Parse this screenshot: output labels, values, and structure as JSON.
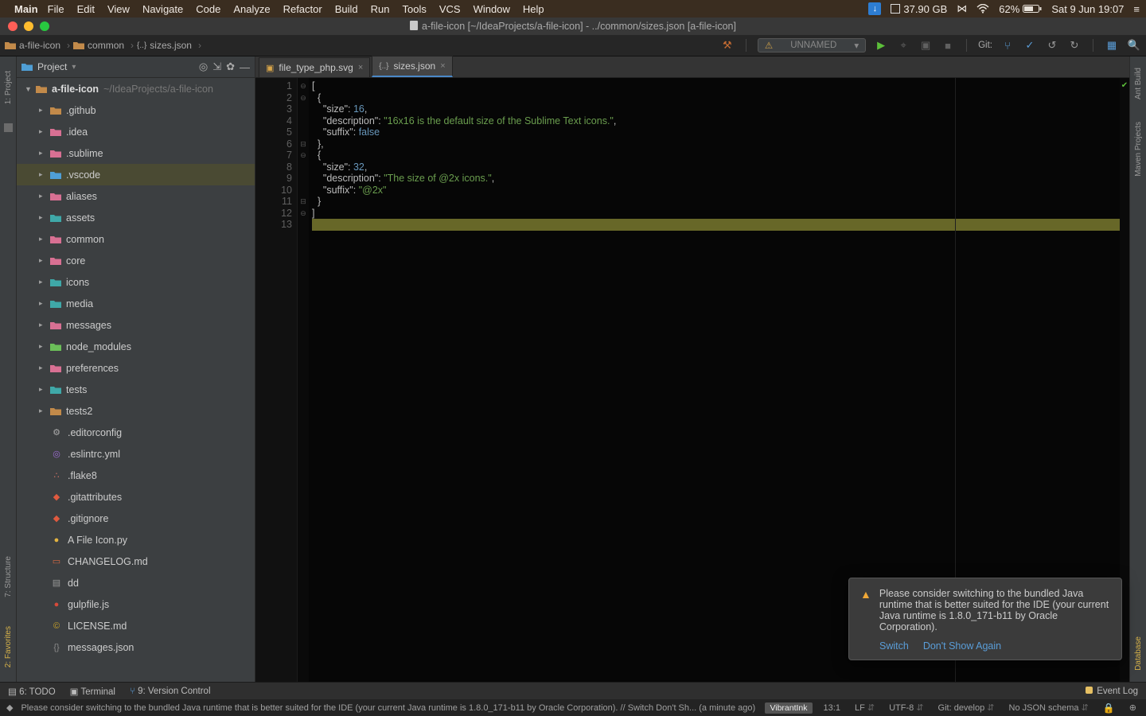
{
  "mac": {
    "app": "Main",
    "menus": [
      "File",
      "Edit",
      "View",
      "Navigate",
      "Code",
      "Analyze",
      "Refactor",
      "Build",
      "Run",
      "Tools",
      "VCS",
      "Window",
      "Help"
    ],
    "disk": "37.90 GB",
    "battery": "62%",
    "clock": "Sat 9 Jun  19:07"
  },
  "window": {
    "title": "a-file-icon [~/IdeaProjects/a-file-icon] - ../common/sizes.json [a-file-icon]"
  },
  "breadcrumb": {
    "items": [
      "a-file-icon",
      "common",
      "sizes.json"
    ]
  },
  "run": {
    "config": "UNNAMED",
    "git_label": "Git:"
  },
  "project": {
    "title": "Project",
    "root": {
      "name": "a-file-icon",
      "path": "~/IdeaProjects/a-file-icon"
    },
    "dirs": [
      {
        "name": ".github",
        "cls": "fi-dir"
      },
      {
        "name": ".idea",
        "cls": "fi-dir-pink"
      },
      {
        "name": ".sublime",
        "cls": "fi-dir-pink"
      },
      {
        "name": ".vscode",
        "cls": "fi-dir-blue",
        "selected": true
      },
      {
        "name": "aliases",
        "cls": "fi-dir-pink"
      },
      {
        "name": "assets",
        "cls": "fi-dir-teal"
      },
      {
        "name": "common",
        "cls": "fi-dir-pink"
      },
      {
        "name": "core",
        "cls": "fi-dir-pink"
      },
      {
        "name": "icons",
        "cls": "fi-dir-teal"
      },
      {
        "name": "media",
        "cls": "fi-dir-teal"
      },
      {
        "name": "messages",
        "cls": "fi-dir-pink"
      },
      {
        "name": "node_modules",
        "cls": "fi-dir-green"
      },
      {
        "name": "preferences",
        "cls": "fi-dir-pink"
      },
      {
        "name": "tests",
        "cls": "fi-dir-teal"
      },
      {
        "name": "tests2",
        "cls": "fi-dir"
      }
    ],
    "files": [
      {
        "name": ".editorconfig",
        "ic": "⚙",
        "col": "#aaa"
      },
      {
        "name": ".eslintrc.yml",
        "ic": "◎",
        "col": "#9b6bd1"
      },
      {
        "name": ".flake8",
        "ic": "∴",
        "col": "#cc7164"
      },
      {
        "name": ".gitattributes",
        "ic": "◆",
        "col": "#e05a3f"
      },
      {
        "name": ".gitignore",
        "ic": "◆",
        "col": "#e05a3f"
      },
      {
        "name": "A File Icon.py",
        "ic": "●",
        "col": "#e3b341"
      },
      {
        "name": "CHANGELOG.md",
        "ic": "▭",
        "col": "#d96a43"
      },
      {
        "name": "dd",
        "ic": "▤",
        "col": "#999"
      },
      {
        "name": "gulpfile.js",
        "ic": "●",
        "col": "#d64a3a"
      },
      {
        "name": "LICENSE.md",
        "ic": "©",
        "col": "#c9a227"
      },
      {
        "name": "messages.json",
        "ic": "{}",
        "col": "#888"
      }
    ]
  },
  "tabs": [
    {
      "label": "file_type_php.svg",
      "active": false
    },
    {
      "label": "sizes.json",
      "active": true
    }
  ],
  "code": {
    "lines": [
      {
        "n": 1,
        "html": "<span class='p'>[</span>"
      },
      {
        "n": 2,
        "html": "  <span class='p'>{</span>"
      },
      {
        "n": 3,
        "html": "    <span class='q'>\"size\"</span><span class='p'>: </span><span class='n'>16</span><span class='p'>,</span>"
      },
      {
        "n": 4,
        "html": "    <span class='q'>\"description\"</span><span class='p'>: </span><span class='s'>\"16x16 is the default size of the Sublime Text icons.\"</span><span class='p'>,</span>"
      },
      {
        "n": 5,
        "html": "    <span class='q'>\"suffix\"</span><span class='p'>: </span><span class='b'>false</span>"
      },
      {
        "n": 6,
        "html": "  <span class='p'>},</span>"
      },
      {
        "n": 7,
        "html": "  <span class='p'>{</span>"
      },
      {
        "n": 8,
        "html": "    <span class='q'>\"size\"</span><span class='p'>: </span><span class='n'>32</span><span class='p'>,</span>"
      },
      {
        "n": 9,
        "html": "    <span class='q'>\"description\"</span><span class='p'>: </span><span class='s'>\"The size of @2x icons.\"</span><span class='p'>,</span>"
      },
      {
        "n": 10,
        "html": "    <span class='q'>\"suffix\"</span><span class='p'>: </span><span class='s'>\"@2x\"</span>"
      },
      {
        "n": 11,
        "html": "  <span class='p'>}</span>"
      },
      {
        "n": 12,
        "html": "<span class='p'>]</span>"
      },
      {
        "n": 13,
        "html": "",
        "cur": true
      }
    ]
  },
  "leftgutter": {
    "items": [
      "1: Project",
      "7: Structure",
      "2: Favorites"
    ]
  },
  "rightgutter": {
    "items": [
      "Ant Build",
      "Maven Projects",
      "Database"
    ]
  },
  "notification": {
    "text": "Please consider switching to the bundled Java runtime that is better suited for the IDE (your current Java runtime is 1.8.0_171-b11 by Oracle Corporation).",
    "act1": "Switch",
    "act2": "Don't Show Again"
  },
  "bottom": {
    "todo": "6: TODO",
    "terminal": "Terminal",
    "vcs": "9: Version Control",
    "event": "Event Log"
  },
  "status": {
    "msg": "Please consider switching to the bundled Java runtime that is better suited for the IDE (your current Java runtime is 1.8.0_171-b11 by Oracle Corporation). // Switch Don't Sh... (a minute ago)",
    "theme": "VibrantInk",
    "pos": "13:1",
    "le": "LF",
    "enc": "UTF-8",
    "branch": "Git: develop",
    "schema": "No JSON schema"
  }
}
